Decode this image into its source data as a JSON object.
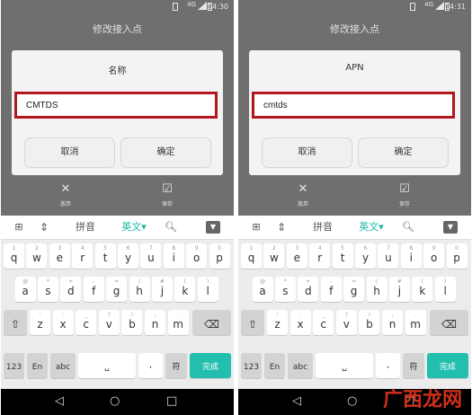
{
  "panels": [
    {
      "status": {
        "time": "14:30",
        "network": "4G"
      },
      "title": "修改接入点",
      "dialog": {
        "title": "名称",
        "value": "CMTDS",
        "cancel": "取消",
        "ok": "确定"
      },
      "actions": {
        "discard": "放弃",
        "save": "保存"
      }
    },
    {
      "status": {
        "time": "14:31",
        "network": "4G"
      },
      "title": "修改接入点",
      "dialog": {
        "title": "APN",
        "value": "cmtds",
        "cancel": "取消",
        "ok": "确定"
      },
      "actions": {
        "discard": "放弃",
        "save": "保存"
      }
    }
  ],
  "keyboard": {
    "toolbar": {
      "pinyin": "拼音",
      "english": "英文▾",
      "grid_icon": "grid-icon",
      "cursor_icon": "cursor-move-icon",
      "search_icon": "search-icon",
      "hide_icon": "keyboard-hide-icon"
    },
    "row1": [
      {
        "ch": "q",
        "hint": "1"
      },
      {
        "ch": "w",
        "hint": "2"
      },
      {
        "ch": "e",
        "hint": "3"
      },
      {
        "ch": "r",
        "hint": "4"
      },
      {
        "ch": "t",
        "hint": "5"
      },
      {
        "ch": "y",
        "hint": "6"
      },
      {
        "ch": "u",
        "hint": "7"
      },
      {
        "ch": "i",
        "hint": "8"
      },
      {
        "ch": "o",
        "hint": "9"
      },
      {
        "ch": "p",
        "hint": "0"
      }
    ],
    "row2": [
      {
        "ch": "a",
        "hint": "@"
      },
      {
        "ch": "s",
        "hint": "*"
      },
      {
        "ch": "d",
        "hint": "+"
      },
      {
        "ch": "f",
        "hint": "-"
      },
      {
        "ch": "g",
        "hint": "="
      },
      {
        "ch": "h",
        "hint": "/"
      },
      {
        "ch": "j",
        "hint": "#"
      },
      {
        "ch": "k",
        "hint": "("
      },
      {
        "ch": "l",
        "hint": ")"
      }
    ],
    "row3": [
      {
        "ch": "z",
        "hint": "'"
      },
      {
        "ch": "x",
        "hint": ":"
      },
      {
        "ch": "c",
        "hint": "_"
      },
      {
        "ch": "v",
        "hint": "?"
      },
      {
        "ch": "b",
        "hint": "!"
      },
      {
        "ch": "n",
        "hint": ","
      },
      {
        "ch": "m",
        "hint": "."
      }
    ],
    "shift": "⇧",
    "backspace": "⌫",
    "bottom": {
      "num": "123",
      "lang": "En",
      "abc": "abc",
      "space": "␣",
      "dot": "·",
      "symbol": "符",
      "done": "完成"
    },
    "accent_color": "#22bfae"
  },
  "navbar": {
    "back": "◁",
    "home": "○",
    "recent": "□"
  },
  "watermark": "广西龙网"
}
